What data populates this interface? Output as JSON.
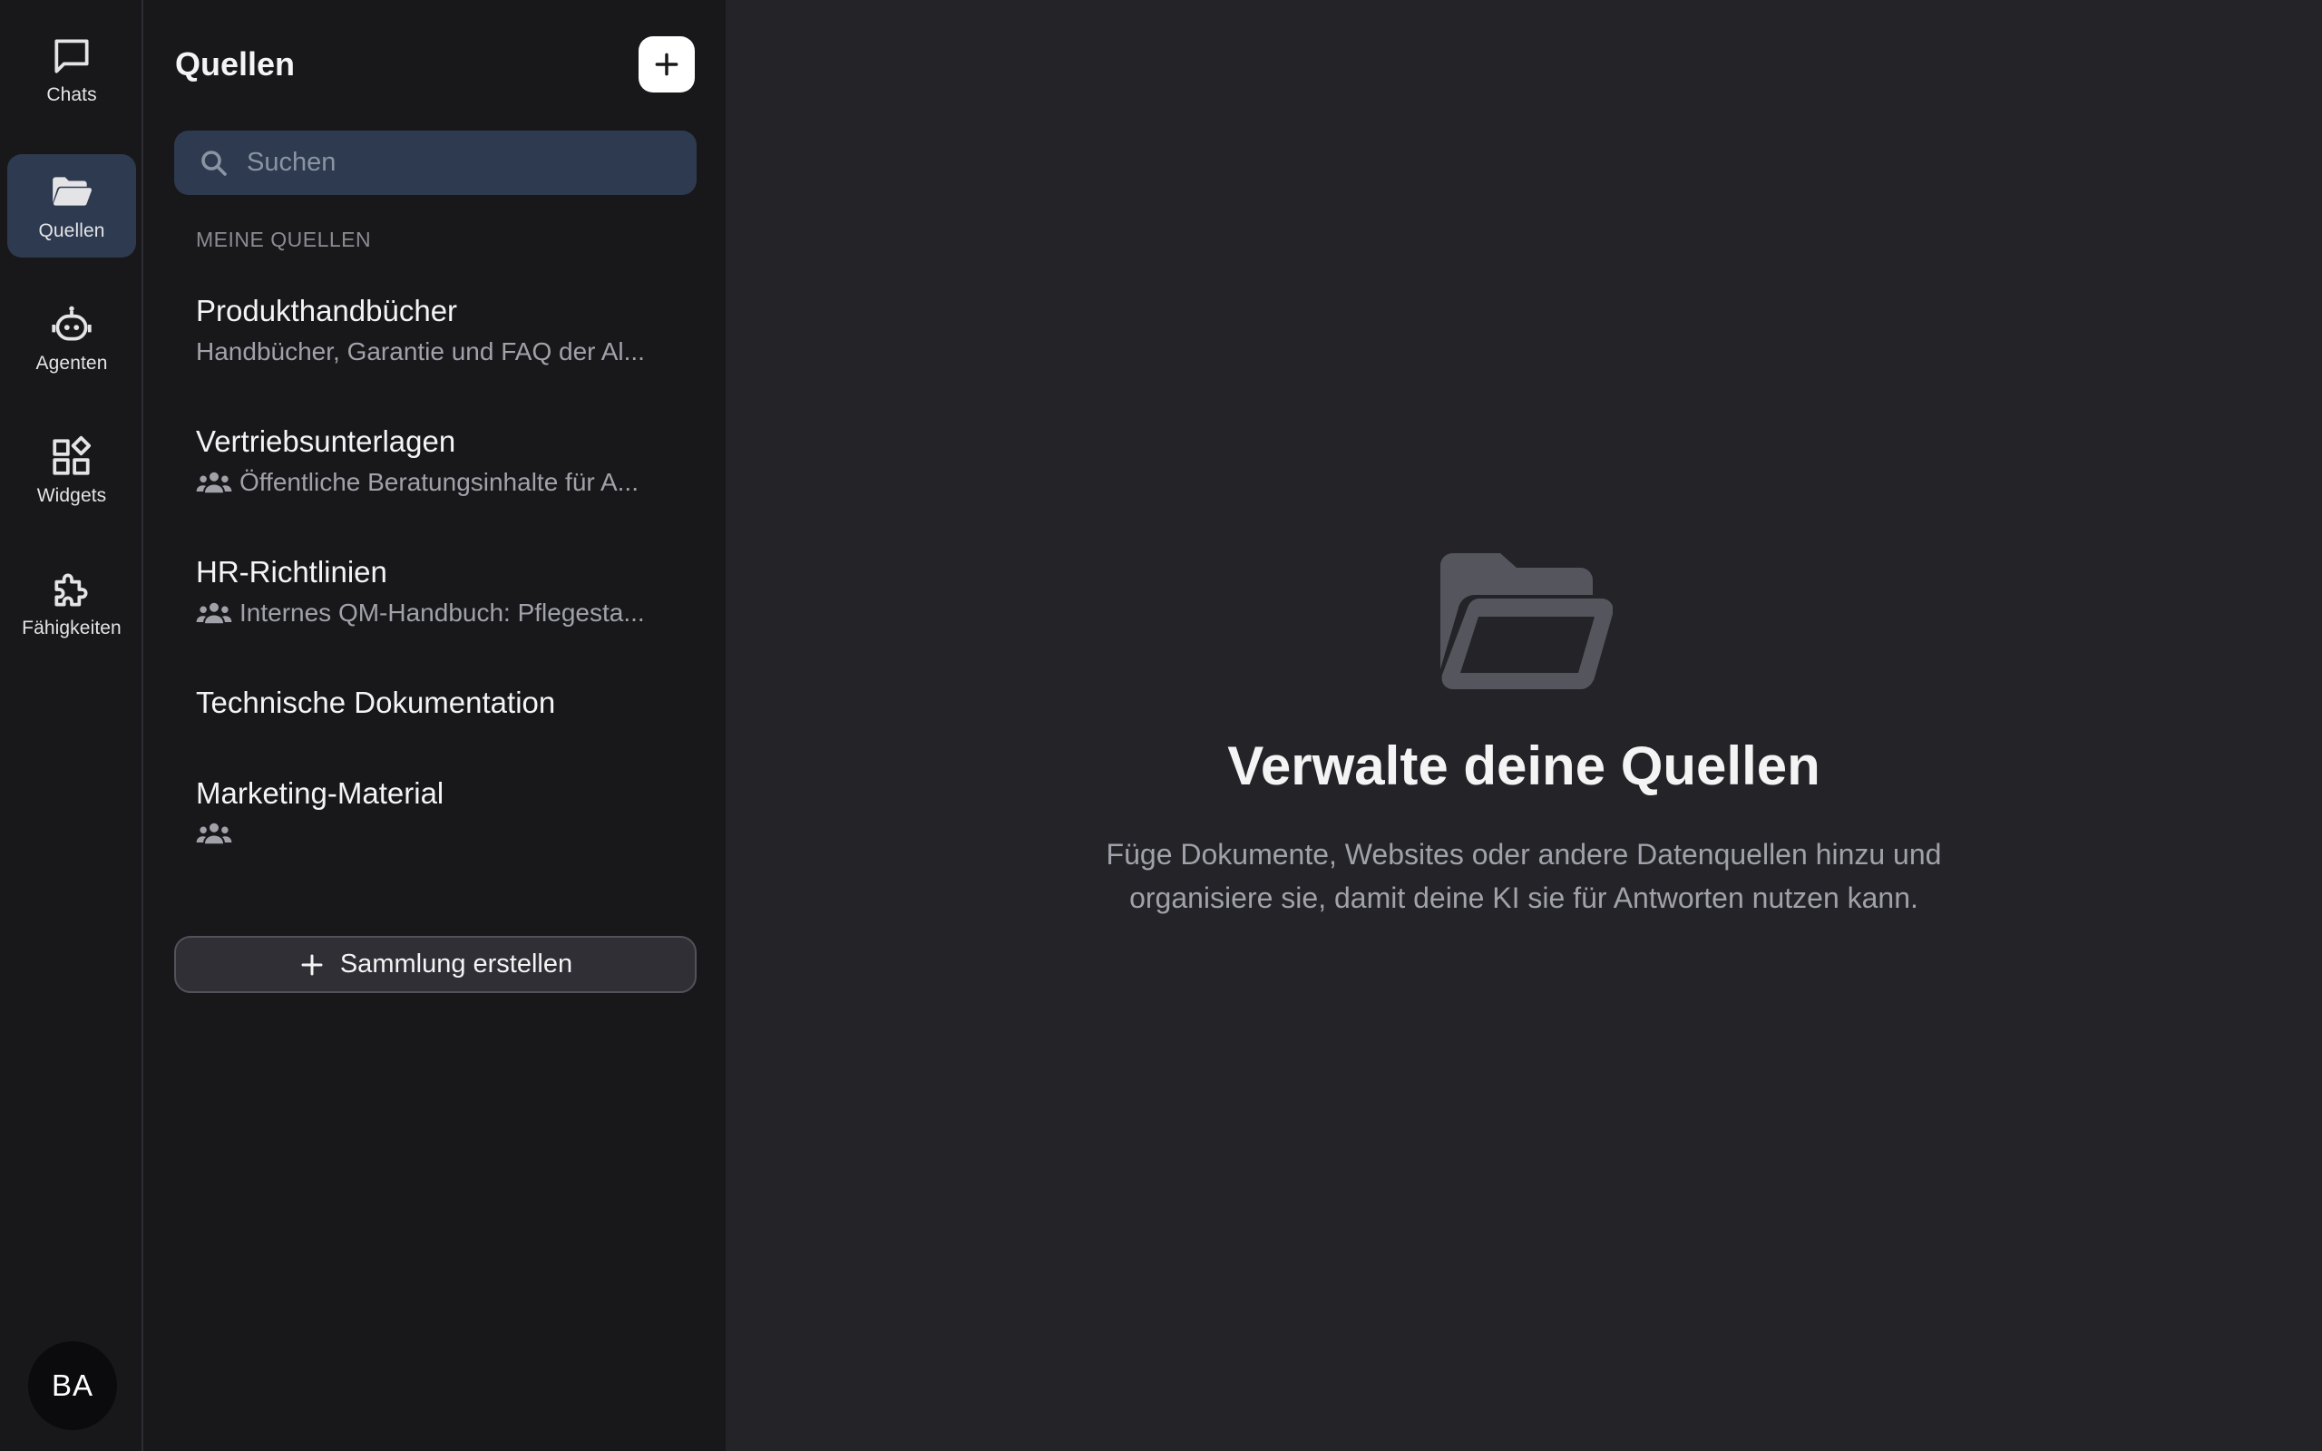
{
  "rail": {
    "items": [
      {
        "label": "Chats",
        "icon": "chat-bubble-icon",
        "active": false
      },
      {
        "label": "Quellen",
        "icon": "folder-open-icon",
        "active": true
      },
      {
        "label": "Agenten",
        "icon": "robot-icon",
        "active": false
      },
      {
        "label": "Widgets",
        "icon": "widgets-icon",
        "active": false
      },
      {
        "label": "Fähigkeiten",
        "icon": "puzzle-icon",
        "active": false
      }
    ],
    "avatar_initials": "BA"
  },
  "panel": {
    "title": "Quellen",
    "search_placeholder": "Suchen",
    "section_label": "MEINE QUELLEN",
    "sources": [
      {
        "title": "Produkthandbücher",
        "description": "Handbücher, Garantie und FAQ der Al...",
        "shared": false
      },
      {
        "title": "Vertriebsunterlagen",
        "description": "Öffentliche Beratungsinhalte für A...",
        "shared": true
      },
      {
        "title": "HR-Richtlinien",
        "description": "Internes QM-Handbuch: Pflegesta...",
        "shared": true
      },
      {
        "title": "Technische Dokumentation",
        "description": "",
        "shared": false
      },
      {
        "title": "Marketing-Material",
        "description": "",
        "shared": true
      }
    ],
    "create_label": "Sammlung erstellen"
  },
  "main": {
    "empty_icon": "folder-open-icon",
    "title": "Verwalte deine Quellen",
    "description_line1": "Füge Dokumente, Websites oder andere Datenquellen hinzu und",
    "description_line2": "organisiere sie, damit deine KI sie für Antworten nutzen kann."
  },
  "colors": {
    "rail_bg": "#18181b",
    "main_bg": "#232328",
    "active_bg": "#2e3a4f",
    "search_bg": "#2e3a4f"
  }
}
